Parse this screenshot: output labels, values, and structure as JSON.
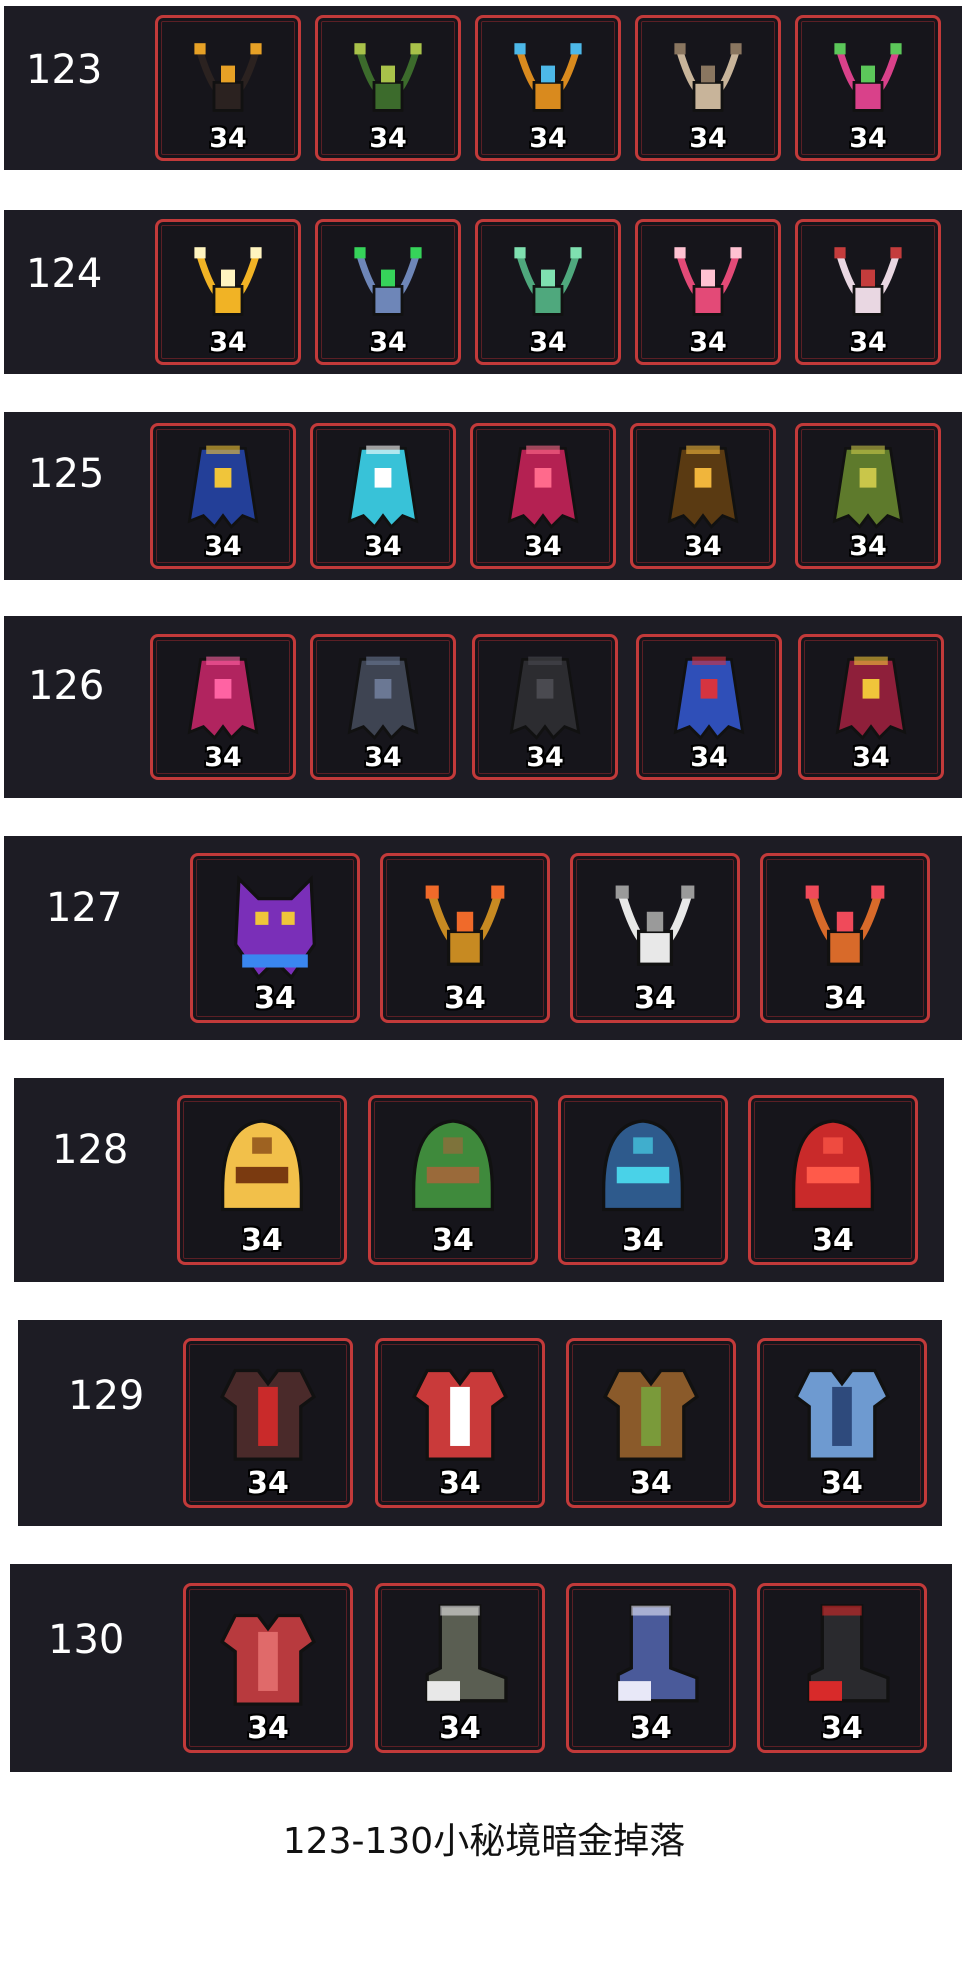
{
  "rows": [
    {
      "level": "123",
      "items": [
        {
          "name": "dark-horned-necklace-icon",
          "qty": "34",
          "main": "#2b2220",
          "accent": "#e7a126",
          "kind": "necklace"
        },
        {
          "name": "green-gem-necklace-icon",
          "qty": "34",
          "main": "#3c6b2c",
          "accent": "#a9c24a",
          "kind": "necklace"
        },
        {
          "name": "blue-crystal-necklace-icon",
          "qty": "34",
          "main": "#d98a1e",
          "accent": "#4db8e8",
          "kind": "necklace"
        },
        {
          "name": "bone-ring-necklace-icon",
          "qty": "34",
          "main": "#c8b49a",
          "accent": "#8a7660",
          "kind": "necklace"
        },
        {
          "name": "green-skull-pink-necklace-icon",
          "qty": "34",
          "main": "#d9418a",
          "accent": "#5cc75a",
          "kind": "necklace"
        }
      ]
    },
    {
      "level": "124",
      "items": [
        {
          "name": "golden-ring-necklace-icon",
          "qty": "34",
          "main": "#f1b325",
          "accent": "#fff4c0",
          "kind": "necklace"
        },
        {
          "name": "lightning-necklace-icon",
          "qty": "34",
          "main": "#6e86b8",
          "accent": "#36d35a",
          "kind": "necklace"
        },
        {
          "name": "green-beetle-necklace-icon",
          "qty": "34",
          "main": "#4fa87d",
          "accent": "#7fe0b0",
          "kind": "necklace"
        },
        {
          "name": "pink-shell-necklace-icon",
          "qty": "34",
          "main": "#e34a77",
          "accent": "#ffc2d2",
          "kind": "necklace"
        },
        {
          "name": "dice-necklace-icon",
          "qty": "34",
          "main": "#e9d7e2",
          "accent": "#c43c3c",
          "kind": "necklace"
        }
      ]
    },
    {
      "level": "125",
      "items": [
        {
          "name": "blue-holy-cloak-icon",
          "qty": "34",
          "main": "#233f98",
          "accent": "#f0c53a",
          "kind": "cloak"
        },
        {
          "name": "ice-feather-cloak-icon",
          "qty": "34",
          "main": "#38c2d8",
          "accent": "#ffffff",
          "kind": "cloak"
        },
        {
          "name": "crimson-demon-cloak-icon",
          "qty": "34",
          "main": "#b42152",
          "accent": "#ff6a8c",
          "kind": "cloak"
        },
        {
          "name": "starry-brown-cloak-icon",
          "qty": "34",
          "main": "#5a3a12",
          "accent": "#f0b53c",
          "kind": "cloak"
        },
        {
          "name": "olive-lattice-cloak-icon",
          "qty": "34",
          "main": "#5e7a2c",
          "accent": "#c9c64a",
          "kind": "cloak"
        }
      ]
    },
    {
      "level": "126",
      "items": [
        {
          "name": "magenta-tentacle-cloak-icon",
          "qty": "34",
          "main": "#b1245f",
          "accent": "#ff63a3",
          "kind": "cloak"
        },
        {
          "name": "slate-feather-cloak-icon",
          "qty": "34",
          "main": "#3e4452",
          "accent": "#6b7894",
          "kind": "cloak"
        },
        {
          "name": "shadow-cloak-icon",
          "qty": "34",
          "main": "#2c2c30",
          "accent": "#4a4a50",
          "kind": "cloak"
        },
        {
          "name": "blue-red-wing-cloak-icon",
          "qty": "34",
          "main": "#2f4fb8",
          "accent": "#d63440",
          "kind": "cloak"
        },
        {
          "name": "crimson-eye-cloak-icon",
          "qty": "34",
          "main": "#8e1f3a",
          "accent": "#f0c53a",
          "kind": "cloak"
        }
      ]
    },
    {
      "level": "127",
      "items": [
        {
          "name": "purple-demon-amulet-icon",
          "qty": "34",
          "main": "#7a2fb8",
          "accent": "#3a86f0",
          "kind": "demon"
        },
        {
          "name": "golden-chain-amulet-icon",
          "qty": "34",
          "main": "#c78a22",
          "accent": "#f06a2a",
          "kind": "necklace"
        },
        {
          "name": "stethoscope-icon",
          "qty": "34",
          "main": "#e8e8e8",
          "accent": "#9a9a9a",
          "kind": "necklace"
        },
        {
          "name": "heart-chain-amulet-icon",
          "qty": "34",
          "main": "#d86a2a",
          "accent": "#f04a5a",
          "kind": "necklace"
        }
      ]
    },
    {
      "level": "128",
      "items": [
        {
          "name": "golden-flame-helmet-icon",
          "qty": "34",
          "main": "#f2c04a",
          "accent": "#7a3a10",
          "kind": "helmet"
        },
        {
          "name": "green-soldier-helmet-icon",
          "qty": "34",
          "main": "#3f8a3c",
          "accent": "#9a6a3a",
          "kind": "helmet"
        },
        {
          "name": "blue-cyclops-helmet-icon",
          "qty": "34",
          "main": "#2e5a8c",
          "accent": "#49d2e8",
          "kind": "helmet"
        },
        {
          "name": "red-crown-helmet-icon",
          "qty": "34",
          "main": "#c92a2a",
          "accent": "#ff5a4a",
          "kind": "helmet"
        }
      ]
    },
    {
      "level": "129",
      "items": [
        {
          "name": "dark-spiked-armor-icon",
          "qty": "34",
          "main": "#4a2a2a",
          "accent": "#c92a2a",
          "kind": "armor"
        },
        {
          "name": "red-white-robe-icon",
          "qty": "34",
          "main": "#c93a3a",
          "accent": "#ffffff",
          "kind": "armor"
        },
        {
          "name": "leaf-leather-armor-icon",
          "qty": "34",
          "main": "#8a5a2a",
          "accent": "#7a9a3a",
          "kind": "armor"
        },
        {
          "name": "blue-plate-armor-icon",
          "qty": "34",
          "main": "#6e9ad0",
          "accent": "#2e4a7c",
          "kind": "armor"
        }
      ]
    },
    {
      "level": "130",
      "items": [
        {
          "name": "red-dragon-armor-icon",
          "qty": "34",
          "main": "#b83a3e",
          "accent": "#e06a6a",
          "kind": "armor"
        },
        {
          "name": "stone-boot-icon",
          "qty": "34",
          "main": "#5a5e52",
          "accent": "#e8e8e8",
          "kind": "boot"
        },
        {
          "name": "winged-blue-boot-icon",
          "qty": "34",
          "main": "#4a5a9a",
          "accent": "#e8e8f8",
          "kind": "boot"
        },
        {
          "name": "lava-boot-icon",
          "qty": "34",
          "main": "#2a2a2e",
          "accent": "#d82a2a",
          "kind": "boot"
        }
      ]
    }
  ],
  "caption": "123-130小秘境暗金掉落"
}
